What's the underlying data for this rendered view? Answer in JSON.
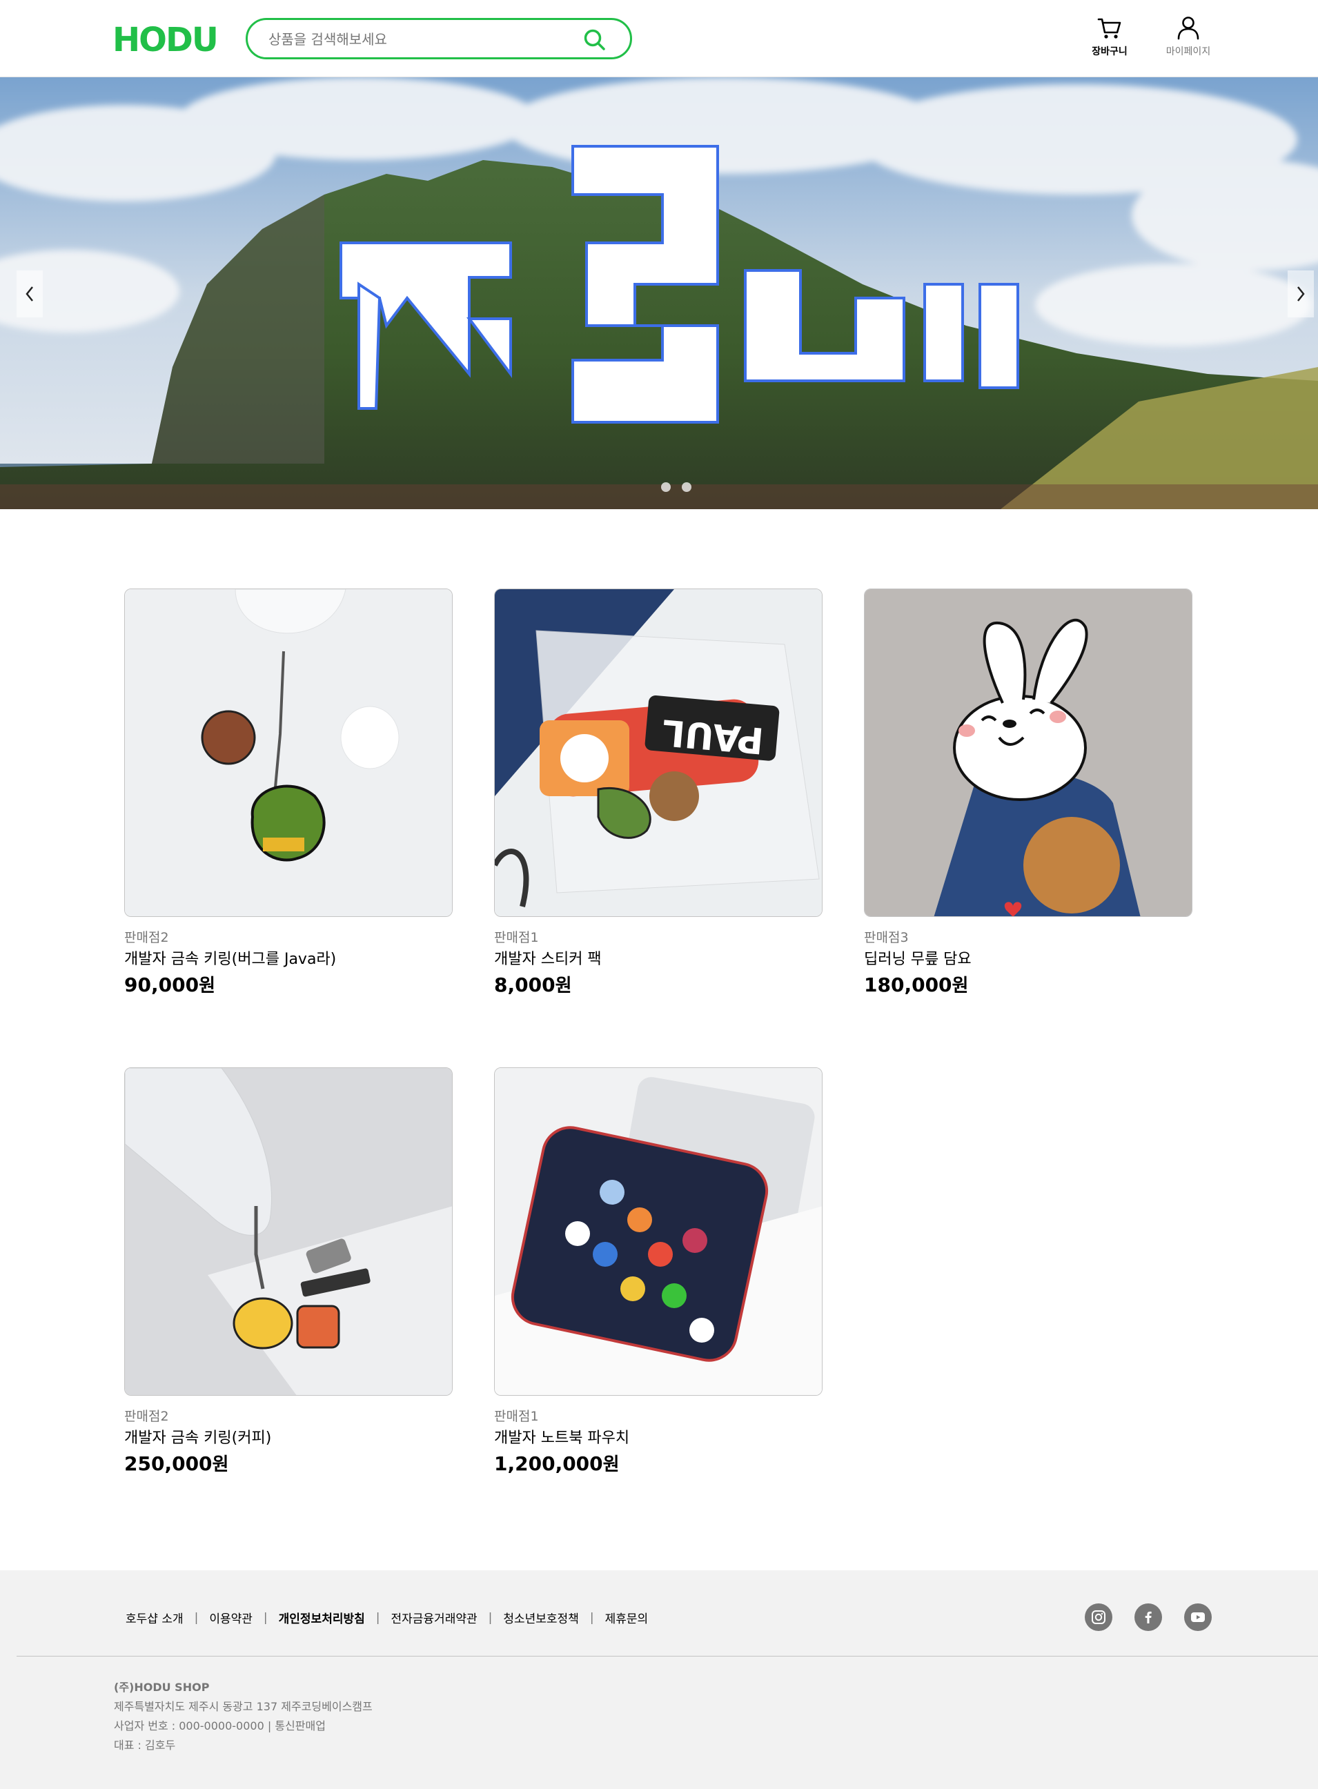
{
  "header": {
    "logo_text": "HODU",
    "search_placeholder": "상품을 검색해보세요",
    "cart_label": "장바구니",
    "mypage_label": "마이페이지"
  },
  "banner": {
    "headline": "저코베",
    "slide_count": 2,
    "active_slide": 1
  },
  "products": [
    {
      "seller": "판매점2",
      "name": "개발자 금속 키링(버그를 Java라)",
      "price": "90,000",
      "unit": "원"
    },
    {
      "seller": "판매점1",
      "name": "개발자 스티커 팩",
      "price": "8,000",
      "unit": "원"
    },
    {
      "seller": "판매점3",
      "name": "딥러닝 무릎 담요",
      "price": "180,000",
      "unit": "원"
    },
    {
      "seller": "판매점2",
      "name": "개발자 금속 키링(커피)",
      "price": "250,000",
      "unit": "원"
    },
    {
      "seller": "판매점1",
      "name": "개발자 노트북 파우치",
      "price": "1,200,000",
      "unit": "원"
    }
  ],
  "footer": {
    "links": [
      {
        "label": "호두샵 소개",
        "bold": false
      },
      {
        "label": "이용약관",
        "bold": false
      },
      {
        "label": "개인정보처리방침",
        "bold": true
      },
      {
        "label": "전자금융거래약관",
        "bold": false
      },
      {
        "label": "청소년보호정책",
        "bold": false
      },
      {
        "label": "제휴문의",
        "bold": false
      }
    ],
    "social": [
      "instagram-icon",
      "facebook-icon",
      "youtube-icon"
    ],
    "company_name": "(주)HODU SHOP",
    "address": "제주특별자치도 제주시 동광고 137 제주코딩베이스캠프",
    "business_no": "사업자 번호 : 000-0000-0000 | 통신판매업",
    "ceo": "대표 : 김호두"
  },
  "colors": {
    "brand_green": "#21bf48",
    "gray": "#767676",
    "footer_bg": "#f2f2f2"
  }
}
